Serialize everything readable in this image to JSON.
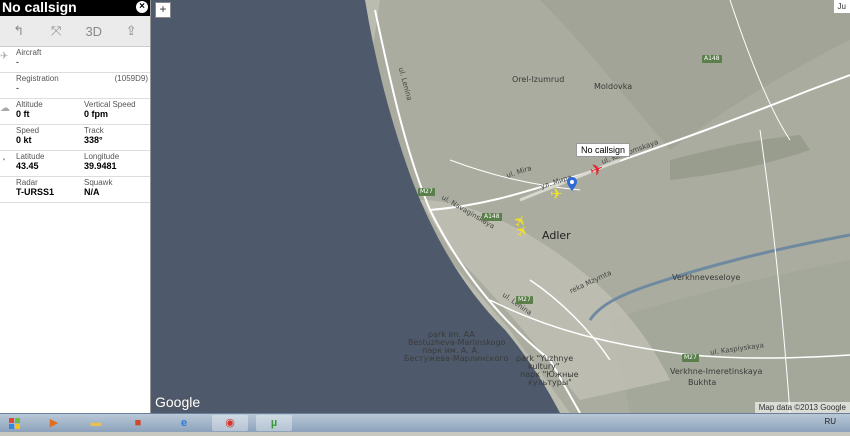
{
  "panel": {
    "title": "No callsign",
    "tools": {
      "route": "↰",
      "fullscreen": "⤧",
      "view3d": "3D",
      "share": "⇪"
    },
    "aircraft": {
      "label": "Aircraft",
      "value": "-"
    },
    "registration": {
      "label": "Registration",
      "code": "(1059D9)",
      "value": "-"
    },
    "altitude": {
      "label": "Altitude",
      "value": "0 ft"
    },
    "vspeed": {
      "label": "Vertical Speed",
      "value": "0 fpm"
    },
    "speed": {
      "label": "Speed",
      "value": "0 kt"
    },
    "track": {
      "label": "Track",
      "value": "338°"
    },
    "latitude": {
      "label": "Latitude",
      "value": "43.45"
    },
    "longitude": {
      "label": "Longitude",
      "value": "39.9481"
    },
    "radar": {
      "label": "Radar",
      "value": "T-URSS1"
    },
    "squawk": {
      "label": "Squawk",
      "value": "N/A"
    }
  },
  "map": {
    "zoom_in": "+",
    "top_right": "Ju",
    "callout": "No callsign",
    "places": {
      "adler": "Adler",
      "orel": "Orel-Izumrud",
      "moldovka": "Moldovka",
      "verkhneveseloye": "Verkhneveseloye",
      "verkhne_imeretinskaya": "Verkhne-Imeretinskaya",
      "bukhta": "Bukhta",
      "park_aa": "park im. AA",
      "bestuzheva": "Bestuzheva-Marlinskogo",
      "park_ru1": "парк им. А. А.",
      "park_ru2": "Бестужева-Марлинского",
      "park_yuzh": "park \"Yuzhnye",
      "kultury": "kultury\"",
      "park_yuzh_ru": "парк \"Южные",
      "kultury_ru": "культуры\""
    },
    "roads": {
      "lenina": "ul. Lenina",
      "mira": "ul. Mira",
      "mira2": "ул. Мира",
      "kostromskaya": "ul. Kostromskaya",
      "navaginskaya": "ul. Navaginskaya",
      "kaspiyskaya": "ul. Kaspiyskaya",
      "mzymta": "reka Mzymta",
      "gogolya": "ul. Gogolya",
      "frunze": "ul. Frunze",
      "a148": "A148",
      "m27": "M27"
    },
    "google": "Google",
    "copyright": "Map data ©2013 Google"
  },
  "taskbar": {
    "lang": "RU"
  },
  "colors": {
    "sea": "#4e5a6b",
    "land": "#b9bcae",
    "road": "#ffffff",
    "plane_selected": "#e8202a",
    "plane": "#f0e02a",
    "marker": "#2f6bd8"
  }
}
